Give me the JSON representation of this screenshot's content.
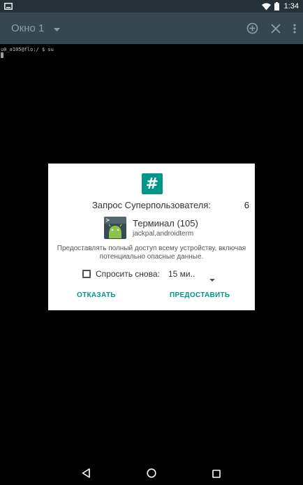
{
  "status_bar": {
    "time": "1:34",
    "icons": [
      "screen-icon",
      "wifi-icon",
      "battery-icon"
    ]
  },
  "toolbar": {
    "window_title": "Окно 1",
    "actions": [
      "add-window-icon",
      "close-window-icon",
      "overflow-menu-icon"
    ]
  },
  "terminal": {
    "prompt_line": "u0_a105@flo:/ $ su"
  },
  "dialog": {
    "icon_glyph": "#",
    "title": "Запрос Суперпользователя:",
    "count": "6",
    "app_name": "Терминал (105)",
    "app_package": "jackpal.androidterm",
    "description": "Предоставлять полный доступ всему устройству, включая потенциально опасные данные.",
    "ask_again_label": "Спросить снова:",
    "ask_again_checked": false,
    "duration_value": "15 ми..",
    "deny_label": "ОТКАЗАТЬ",
    "grant_label": "ПРЕДОСТАВИТЬ",
    "accent_color": "#009688"
  },
  "nav_bar": {
    "buttons": [
      "back-icon",
      "home-icon",
      "recents-icon"
    ]
  }
}
